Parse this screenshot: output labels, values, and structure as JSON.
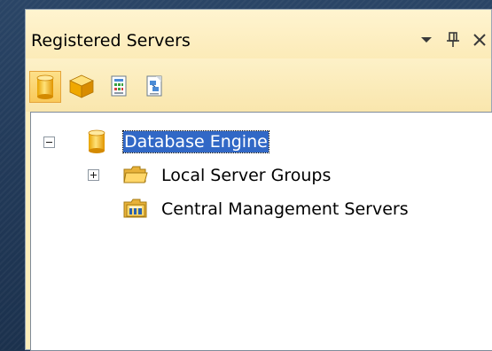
{
  "pane": {
    "title": "Registered Servers"
  },
  "toolbar": {
    "buttons": [
      {
        "icon": "database-engine-icon"
      },
      {
        "icon": "analysis-services-icon"
      },
      {
        "icon": "reporting-services-icon"
      },
      {
        "icon": "integration-services-icon"
      }
    ]
  },
  "tree": {
    "root": {
      "label": "Database Engine",
      "expanded": true,
      "selected": true
    },
    "children": [
      {
        "label": "Local Server Groups",
        "expandable": true
      },
      {
        "label": "Central Management Servers",
        "expandable": false
      }
    ]
  },
  "colors": {
    "pane_background": "#fdeebb",
    "selection": "#3168c6",
    "backdrop": "#223a59"
  }
}
